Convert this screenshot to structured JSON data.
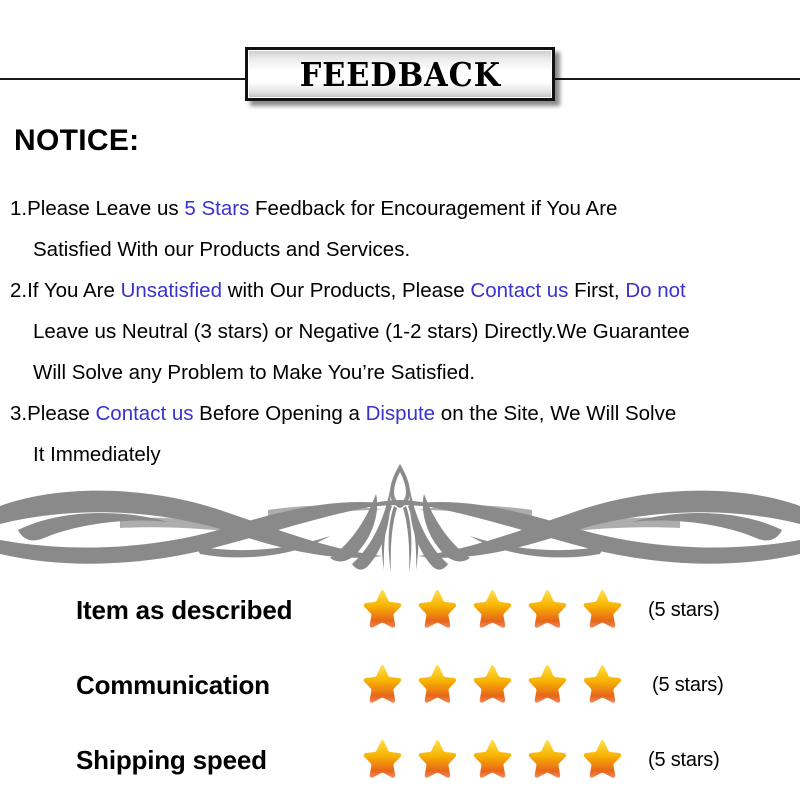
{
  "header": {
    "banner_title": "FEEDBACK",
    "rule_color": "#1a1a1a"
  },
  "notice": {
    "title": "NOTICE",
    "title_colon": ":",
    "highlight_color": "#3a32cc",
    "items": [
      {
        "number": "1.",
        "lines": [
          [
            {
              "text": "1.Please Leave us ",
              "highlight": false
            },
            {
              "text": " 5 Stars ",
              "highlight": true
            },
            {
              "text": " Feedback for  Encouragement  if You Are",
              "highlight": false
            }
          ],
          [
            {
              "text": "Satisfied With our Products and Services.",
              "highlight": false
            }
          ]
        ]
      },
      {
        "number": "2.",
        "lines": [
          [
            {
              "text": "2.If You Are ",
              "highlight": false
            },
            {
              "text": "Unsatisfied",
              "highlight": true
            },
            {
              "text": " with Our Products, Please ",
              "highlight": false
            },
            {
              "text": "Contact us",
              "highlight": true
            },
            {
              "text": " First, ",
              "highlight": false
            },
            {
              "text": "Do not",
              "highlight": true
            }
          ],
          [
            {
              "text": "Leave us Neutral (3 stars) or Negative (1-2 stars) Directly.We Guarantee",
              "highlight": false
            }
          ],
          [
            {
              "text": "Will Solve any Problem to Make You’re  Satisfied.",
              "highlight": false
            }
          ]
        ]
      },
      {
        "number": "3.",
        "lines": [
          [
            {
              "text": "3.Please ",
              "highlight": false
            },
            {
              "text": "Contact us",
              "highlight": true
            },
            {
              "text": " Before Opening a ",
              "highlight": false
            },
            {
              "text": "Dispute",
              "highlight": true
            },
            {
              "text": " on the Site, We Will Solve",
              "highlight": false
            }
          ],
          [
            {
              "text": "It Immediately",
              "highlight": false
            }
          ]
        ]
      }
    ]
  },
  "ornament": {
    "name": "flourish-divider",
    "color": "#8a8a8a"
  },
  "ratings": {
    "star_colors": {
      "top": "#ffe14d",
      "mid": "#f7b400",
      "bottom": "#e8651a",
      "shadow": "#f08a5d"
    },
    "rows": [
      {
        "label": "Item as described",
        "stars": 5,
        "count_text": "(5 stars)"
      },
      {
        "label": "Communication",
        "stars": 5,
        "count_text": "(5 stars)"
      },
      {
        "label": "Shipping speed",
        "stars": 5,
        "count_text": "(5 stars)"
      }
    ]
  }
}
